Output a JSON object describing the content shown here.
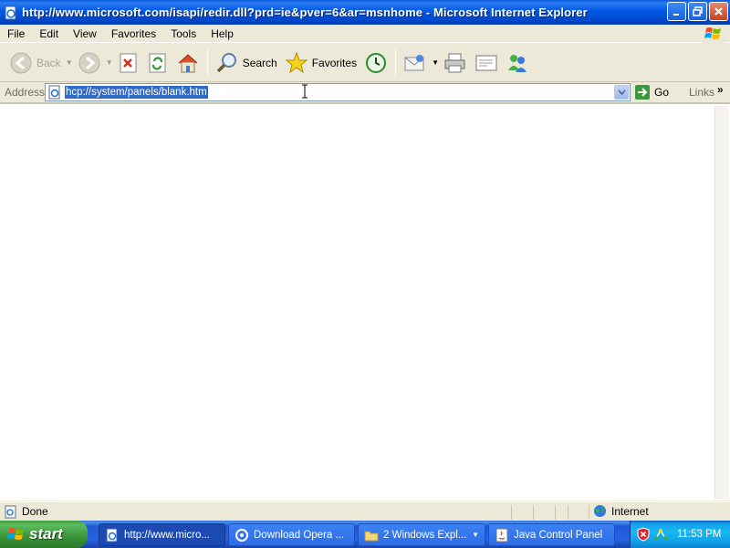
{
  "window": {
    "title": "http://www.microsoft.com/isapi/redir.dll?prd=ie&pver=6&ar=msnhome - Microsoft Internet Explorer"
  },
  "menu": [
    "File",
    "Edit",
    "View",
    "Favorites",
    "Tools",
    "Help"
  ],
  "toolbar": {
    "back_label": "Back",
    "search_label": "Search",
    "favorites_label": "Favorites"
  },
  "address": {
    "label": "Address",
    "url": "hcp://system/panels/blank.htm",
    "go_label": "Go",
    "links_label": "Links"
  },
  "status": {
    "text": "Done",
    "zone": "Internet"
  },
  "taskbar": {
    "start_label": "start",
    "tasks": [
      {
        "label": "http://www.micro...",
        "icon": "ie-icon",
        "active": true
      },
      {
        "label": "Download Opera ...",
        "icon": "opera-icon",
        "active": false
      },
      {
        "label": "2 Windows Expl...",
        "icon": "folder-icon",
        "active": false
      },
      {
        "label": "Java Control Panel",
        "icon": "java-icon",
        "active": false
      }
    ],
    "clock": "11:53 PM"
  },
  "colors": {
    "titlebar": "#0058E6",
    "selection": "#316AC5",
    "start": "#3A943A",
    "tray": "#18B9F0"
  }
}
